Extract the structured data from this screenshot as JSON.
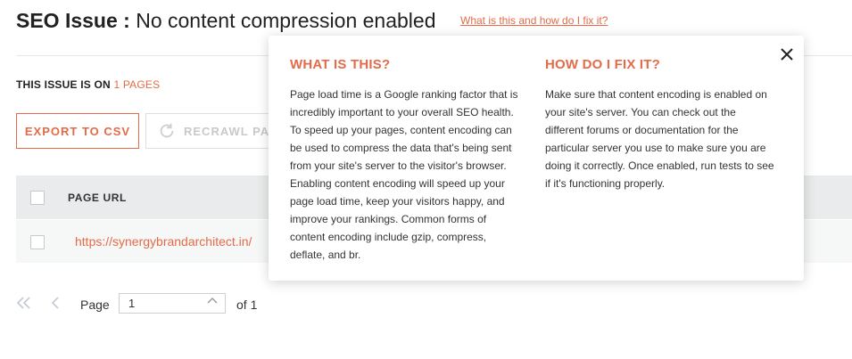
{
  "header": {
    "title_bold": "SEO Issue :",
    "title_rest": "No content compression enabled",
    "help_link": "What is this and how do I fix it?"
  },
  "issue_summary": {
    "prefix": "THIS ISSUE IS ON",
    "count_link": "1 PAGES"
  },
  "toolbar": {
    "export_label": "EXPORT TO CSV",
    "recrawl_label": "RECRAWL PAGES"
  },
  "table": {
    "columns": [
      "PAGE URL"
    ],
    "rows": [
      {
        "url": "https://synergybrandarchitect.in/"
      }
    ]
  },
  "pagination": {
    "page_label": "Page",
    "current_page": "1",
    "of_label": "of 1"
  },
  "popup": {
    "what_heading": "WHAT IS THIS?",
    "what_body": "Page load time is a Google ranking factor that is incredibly important to your overall SEO health. To speed up your pages, content encoding can be used to compress the data that's being sent from your site's server to the visitor's browser. Enabling content encoding will speed up your page load time, keep your visitors happy, and improve your rankings. Common forms of content encoding include gzip, compress, deflate, and br.",
    "fix_heading": "HOW DO I FIX IT?",
    "fix_body": "Make sure that content encoding is enabled on your site's server. You can check out the different forums or documentation for the particular server you use to make sure you are doing it correctly. Once enabled, run tests to see if it's functioning properly."
  },
  "colors": {
    "accent": "#e56a48",
    "table_header_bg": "#e9ebec",
    "row_bg": "#f6f7f7"
  }
}
